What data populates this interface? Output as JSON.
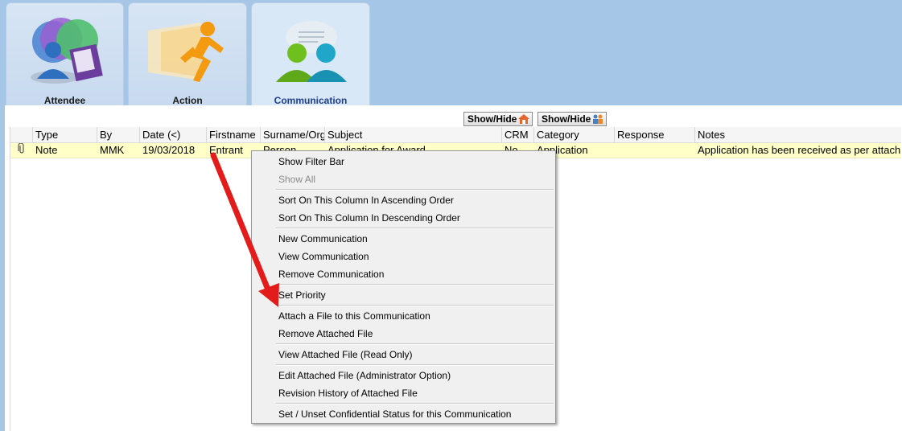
{
  "tabs": [
    {
      "label": "Attendee",
      "icon": "attendee-icon"
    },
    {
      "label": "Action",
      "icon": "running-man-icon"
    },
    {
      "label": "Communication",
      "icon": "people-communication-icon",
      "active": true
    }
  ],
  "toolbar": {
    "show_hide_1": "Show/Hide",
    "show_hide_1_icon": "house-icon",
    "show_hide_2": "Show/Hide",
    "show_hide_2_icon": "people-icon"
  },
  "grid": {
    "columns": [
      "Type",
      "By",
      "Date (<)",
      "Firstname",
      "Surname/Org",
      "Subject",
      "CRM",
      "Category",
      "Response",
      "Notes"
    ],
    "rows": [
      {
        "attachment_icon": "paperclip-icon",
        "type": "Note",
        "by": "MMK",
        "date": "19/03/2018",
        "firstname": "Entrant",
        "surname": "Person",
        "subject": "Application for Award",
        "crm": "No",
        "category": "Application",
        "response": "",
        "notes": "Application has been received as per attach"
      }
    ]
  },
  "context_menu": {
    "items": [
      {
        "label": "Show Filter Bar",
        "enabled": true
      },
      {
        "label": "Show All",
        "enabled": false
      },
      {
        "label": "Sort On This Column In Ascending Order",
        "enabled": true
      },
      {
        "label": "Sort On This Column In Descending Order",
        "enabled": true
      },
      {
        "label": "New Communication",
        "enabled": true
      },
      {
        "label": "View Communication",
        "enabled": true
      },
      {
        "label": "Remove Communication",
        "enabled": true
      },
      {
        "label": "Set Priority",
        "enabled": true
      },
      {
        "label": "Attach a File to this Communication",
        "enabled": true
      },
      {
        "label": "Remove Attached File",
        "enabled": true
      },
      {
        "label": "View Attached File (Read Only)",
        "enabled": true
      },
      {
        "label": "Edit Attached File (Administrator Option)",
        "enabled": true
      },
      {
        "label": "Revision History of Attached File",
        "enabled": true
      },
      {
        "label": "Set / Unset Confidential Status for this Communication",
        "enabled": true
      }
    ]
  },
  "annotation": {
    "arrow_color": "#e31b1b"
  }
}
